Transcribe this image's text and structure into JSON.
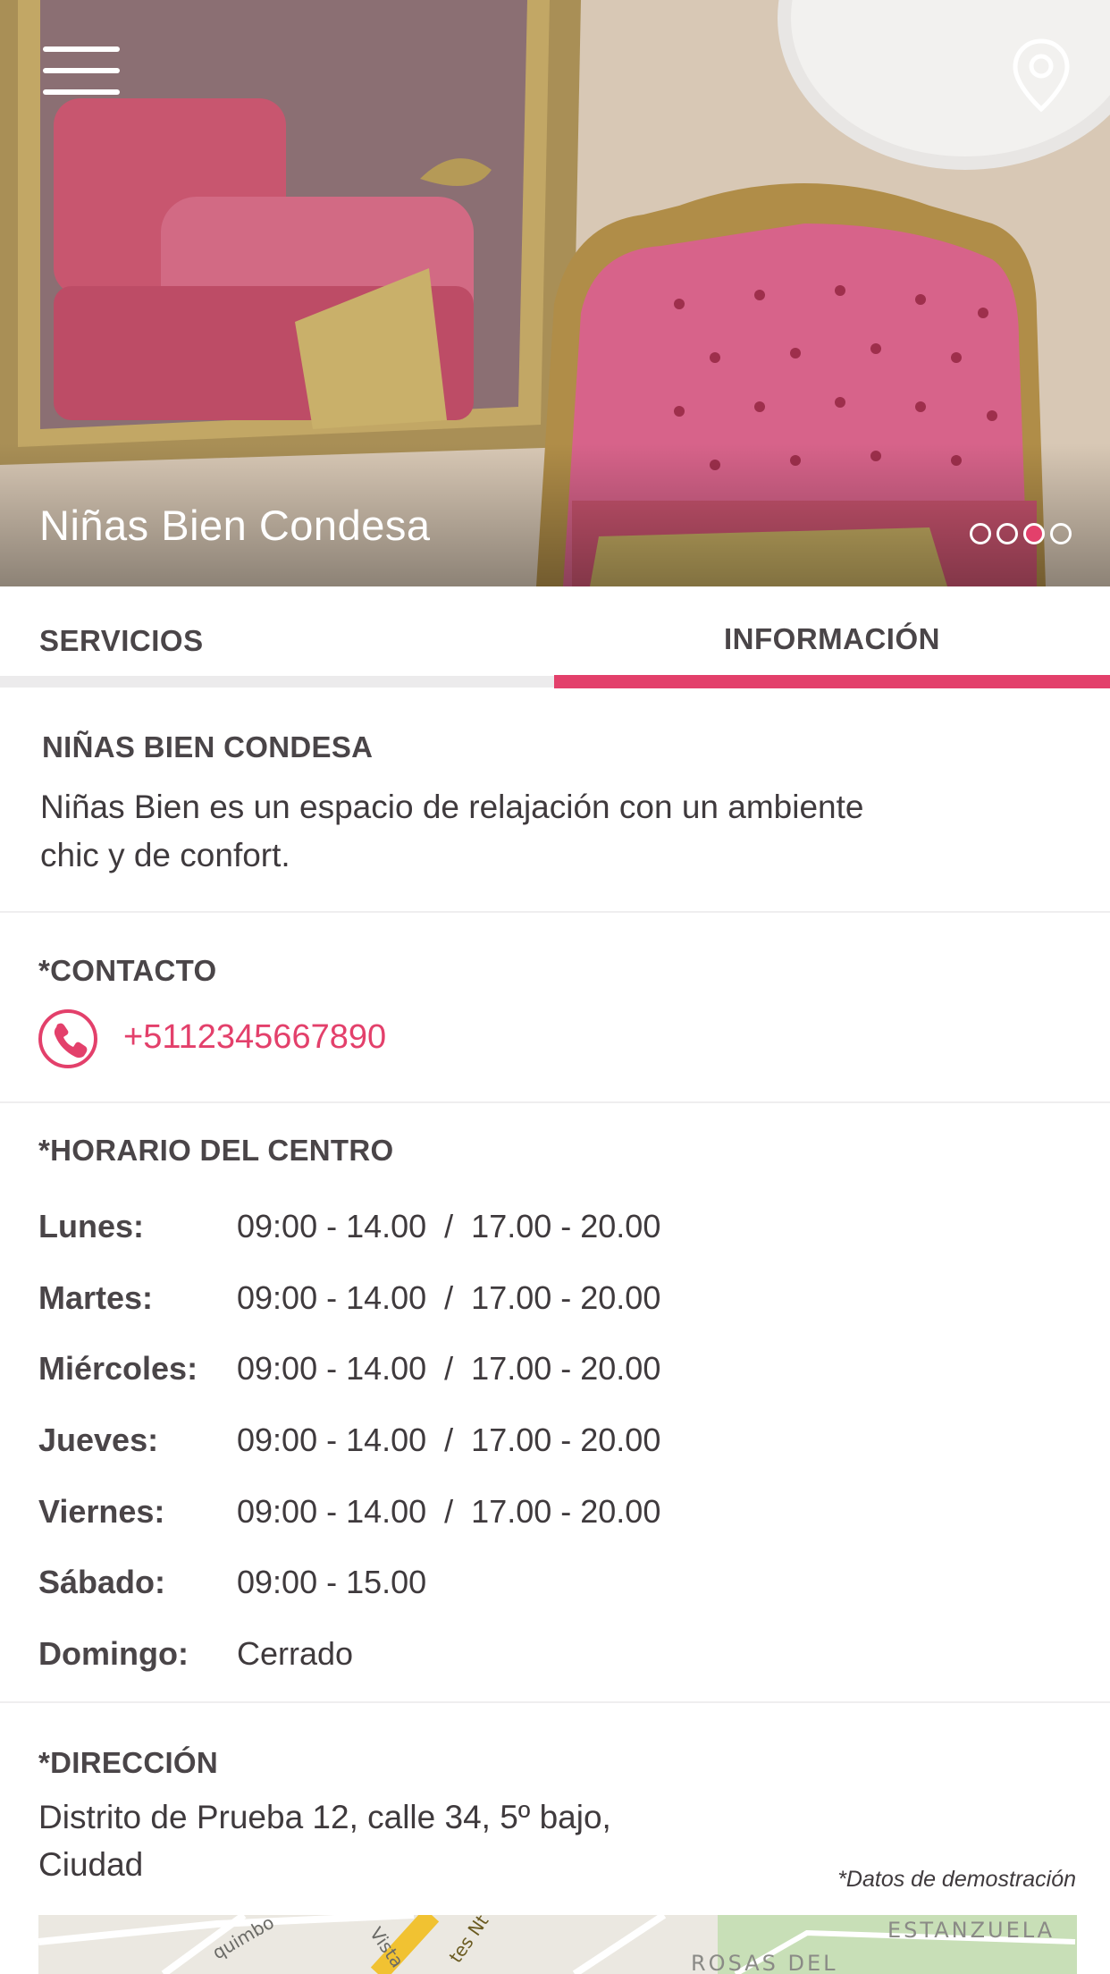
{
  "header": {
    "title": "Niñas Bien Condesa",
    "menu_icon": "hamburger-menu-icon",
    "location_icon": "map-pin-icon",
    "carousel": {
      "total": 4,
      "active_index": 2
    }
  },
  "tabs": [
    {
      "label": "SERVICIOS",
      "active": false
    },
    {
      "label": "INFORMACIÓN",
      "active": true
    }
  ],
  "about": {
    "title": "NIÑAS BIEN CONDESA",
    "description_line1": "Niñas Bien es un espacio de relajación con un ambiente",
    "description_line2": "chic y de confort."
  },
  "contact": {
    "title": "*CONTACTO",
    "phone": "+5112345667890",
    "phone_icon": "phone-icon"
  },
  "hours": {
    "title": "*HORARIO DEL CENTRO",
    "rows": [
      {
        "day": "Lunes:",
        "time": "09:00 - 14.00  /  17.00 - 20.00"
      },
      {
        "day": "Martes:",
        "time": "09:00 - 14.00  /  17.00 - 20.00"
      },
      {
        "day": "Miércoles:",
        "time": "09:00 - 14.00  /  17.00 - 20.00"
      },
      {
        "day": "Jueves:",
        "time": "09:00 - 14.00  /  17.00 - 20.00"
      },
      {
        "day": "Viernes:",
        "time": "09:00 - 14.00  /  17.00 - 20.00"
      },
      {
        "day": "Sábado:",
        "time": "09:00 - 15.00"
      },
      {
        "day": "Domingo:",
        "time": "Cerrado"
      }
    ]
  },
  "address": {
    "title": "*DIRECCIÓN",
    "line1": "Distrito de Prueba 12, calle 34, 5º bajo,",
    "line2": "Ciudad",
    "note": "*Datos de demostración"
  },
  "map": {
    "labels": [
      "ESTANZUELA",
      "ROSAS DEL",
      "quimbo",
      "Vista",
      "tes Nt"
    ]
  },
  "colors": {
    "accent": "#e3406b",
    "text": "#3f3a3d",
    "tab_track": "#ecebec"
  }
}
